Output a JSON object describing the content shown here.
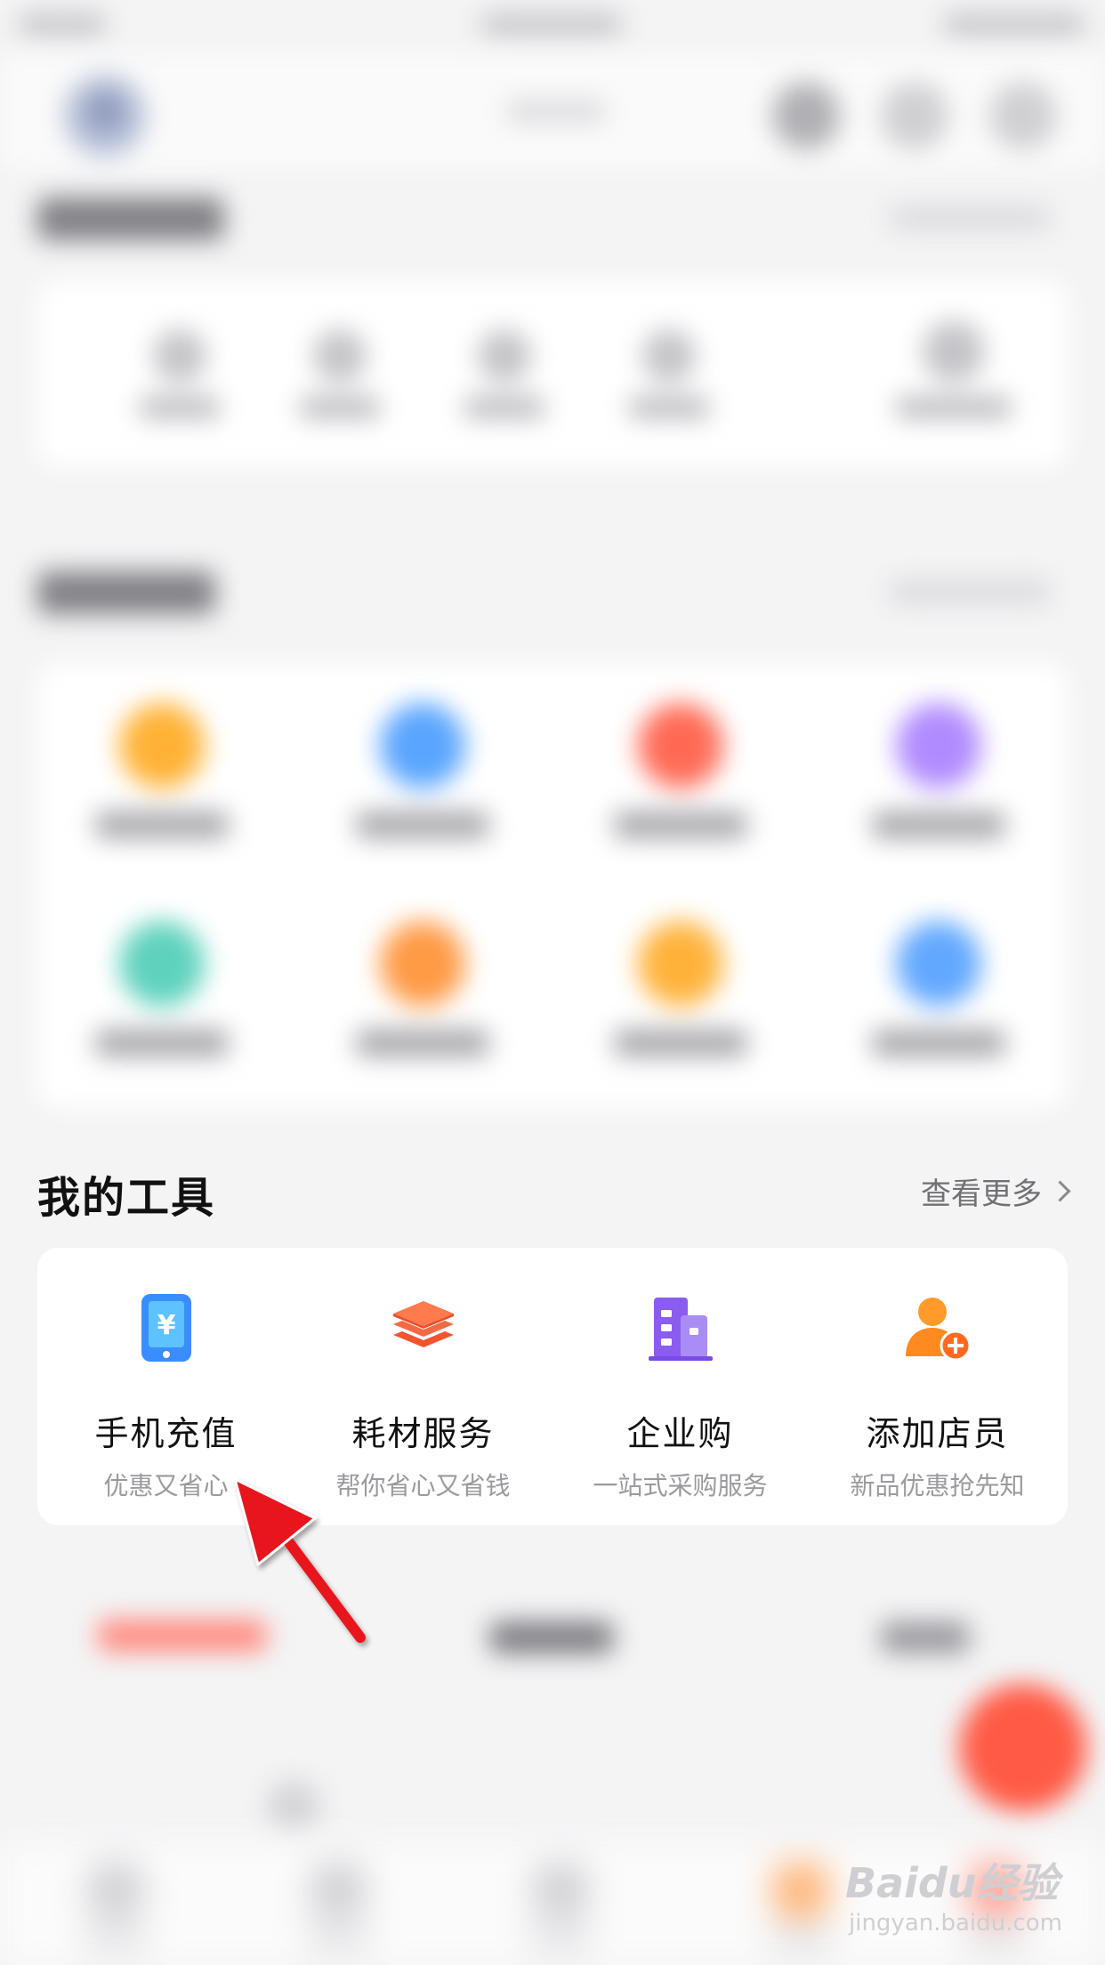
{
  "my_tools": {
    "title": "我的工具",
    "more_label": "查看更多",
    "items": [
      {
        "name": "手机充值",
        "subtitle": "优惠又省心",
        "icon": "phone-recharge-icon",
        "color": "#3a8dff"
      },
      {
        "name": "耗材服务",
        "subtitle": "帮你省心又省钱",
        "icon": "layers-icon",
        "color": "#f2542d"
      },
      {
        "name": "企业购",
        "subtitle": "一站式采购服务",
        "icon": "building-icon",
        "color": "#8a5cf0"
      },
      {
        "name": "添加店员",
        "subtitle": "新品优惠抢先知",
        "icon": "add-staff-icon",
        "color": "#ff8a1f"
      }
    ]
  },
  "colors": {
    "background": "#f4f4f5",
    "card": "#ffffff",
    "annotation_arrow": "#e8141c",
    "fab": "#ff5a45"
  },
  "watermark": {
    "brand": "Baidu经验",
    "url": "jingyan.baidu.com"
  }
}
